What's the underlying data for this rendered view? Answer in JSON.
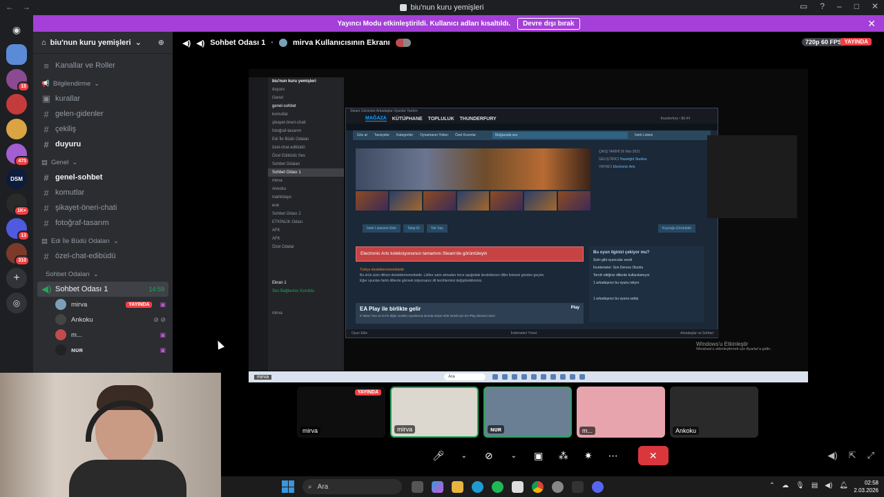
{
  "window": {
    "title": "biu'nun kuru yemişleri",
    "nav_back": "←",
    "nav_fwd": "→"
  },
  "banner": {
    "text": "Yayıncı Modu etkinleştirildi. Kullanıcı adları kısaltıldı.",
    "button": "Devre dışı bırak",
    "close": "✕"
  },
  "server_rail": {
    "badges": [
      "15",
      "475",
      "1K+",
      "13",
      "310"
    ],
    "dsm_label": "DSM"
  },
  "sidebar": {
    "server_name": "biu'nun kuru yemişleri",
    "channels_roles": "Kanallar ve Roller",
    "categories": [
      {
        "name": "Bilgilendirme",
        "channels": [
          "kurallar",
          "gelen-gidenler",
          "çekiliş",
          "duyuru"
        ]
      },
      {
        "name": "Genel",
        "channels": [
          "genel-sohbet",
          "komutlar",
          "şikayet-öneri-chati",
          "fotoğraf-tasarım"
        ]
      },
      {
        "name": "Edi İle Büdü Odaları",
        "channels": [
          "özel-chat-edibüdü"
        ]
      },
      {
        "name": "Sohbet Odaları",
        "channels": []
      }
    ],
    "voice_channel": {
      "name": "Sohbet Odası 1",
      "timer": "14:59"
    },
    "voice_users": [
      {
        "name": "mirva",
        "live": "YAYINDA"
      },
      {
        "name": "Ankoku"
      },
      {
        "name": "m..."
      },
      {
        "name": "ɴᴜʀ"
      }
    ]
  },
  "stage": {
    "channel": "Sohbet Odası 1",
    "stream_title": "mirva Kullanıcısının Ekranı",
    "quality": "720p 60 FPS",
    "live": "YAYINDA"
  },
  "inner_discord": {
    "server_name": "biu'nun kuru yemişleri",
    "channels": [
      "duyuru",
      "Genel",
      "genel-sohbet",
      "komutlar",
      "şikayet-öneri-chati",
      "fotoğraf-tasarım",
      "Edi İle Büdü Odaları",
      "özel-chat-edibüdü",
      "Özel Edibüdü Ses",
      "Sohbet Odaları",
      "Sohbet Odası 1",
      "mirva",
      "Ankoku",
      "mahirdayo",
      "ɴᴜʀ",
      "Sohbet Odası 2",
      "ETKİNLİK Odası",
      "AFK",
      "AFK",
      "Özel Odalar"
    ],
    "screen_share": "Ekran 1",
    "voice_connected": "Ses Bağlantısı Kuruldu",
    "user_label": "mirva",
    "taskbar_label": "mirva",
    "taskbar_search": "Ara"
  },
  "steam": {
    "window_title": "Steam",
    "top_menu": "Steam   Görünüm   Arkadaşlar   Oyunlar   Yardım",
    "user": "thunderfury • $0.44",
    "nav": [
      "MAĞAZA",
      "KÜTÜPHANE",
      "TOPLULUK",
      "THUNDERFURY"
    ],
    "menu": [
      "Göz at",
      "Tavsiyeler",
      "Kategoriler",
      "Oynamanın Yolları",
      "Özel Kısımlar"
    ],
    "search_placeholder": "Mağazada ara",
    "wishlist": "İstek Listesi",
    "info": [
      {
        "label": "GELİŞTİRİCİ",
        "value": "Hazelight Studios"
      },
      {
        "label": "YAYINCI",
        "value": "Electronic Arts"
      },
      {
        "label": "ÇIKIŞ TARİHİ",
        "value": "26 Mar 2021"
      }
    ],
    "buttons": [
      "İstek Listesine Ekle",
      "Takip Et",
      "Yok Say"
    ],
    "queue_btn": "Kuyruğu Görüntüle",
    "ea_warning": "Electronic Arts koleksiyonunun tamamını Steam'de görüntüleyin",
    "lang_title": "Türkçe desteklenmemektedir",
    "lang_text": "Bu ürün sizin dilinizi desteklememektedir. Lütfen satın almadan önce aşağıdaki desteklenen diller listesini gözden geçirin.",
    "lang_text2": "Eğer oyunları farklı dillerde görmek istiyorsanız dil tercihlerinizi değiştirebilirsiniz.",
    "eaplay_title": "EA Play ile birlikte gelir",
    "eaplay_sub": "It Takes Two ve EA'in diğer sevilen oyunlarına anında erişim elde etmek için EA Play abonesi olun!",
    "eaplay_btn": "Play",
    "relevant_title": "Bu oyun ilginizi çekiyor mu?",
    "relevant_items": [
      "Sizin gibi oyuncular sevdi",
      "İncelemeler: Son Derece Olumlu",
      "Tercih ettiğiniz dillerde kullanılamıyor",
      "1 arkadaşınız bu oyunu istiyor",
      "1 arkadaşınız bu oyuna sahip"
    ],
    "footer_left": "Oyun Ekle",
    "footer_mid": "İndirmeleri Yönet",
    "footer_right": "Arkadaşlar ve Sohbet"
  },
  "windows_activation": {
    "title": "Windows'u Etkinleştir",
    "sub": "Windows'u etkinleştirmek için Ayarlar'a gidin."
  },
  "tiles": [
    {
      "name": "mirva",
      "live": "YAYINDA"
    },
    {
      "name": "mirva"
    },
    {
      "name": "ɴᴜʀ"
    },
    {
      "name": "m..."
    },
    {
      "name": "Ankoku"
    }
  ],
  "taskbar": {
    "search": "Ara",
    "time": "02:58",
    "date": "2.03.2026"
  },
  "colors": {
    "discord_bg": "#2b2d31",
    "rail_bg": "#1e1f22",
    "banner": "#a43fd8",
    "live": "#f23f42",
    "steam_bg": "#1b2838",
    "steam_blue": "#1a9fff",
    "ea_red": "#c54443"
  }
}
